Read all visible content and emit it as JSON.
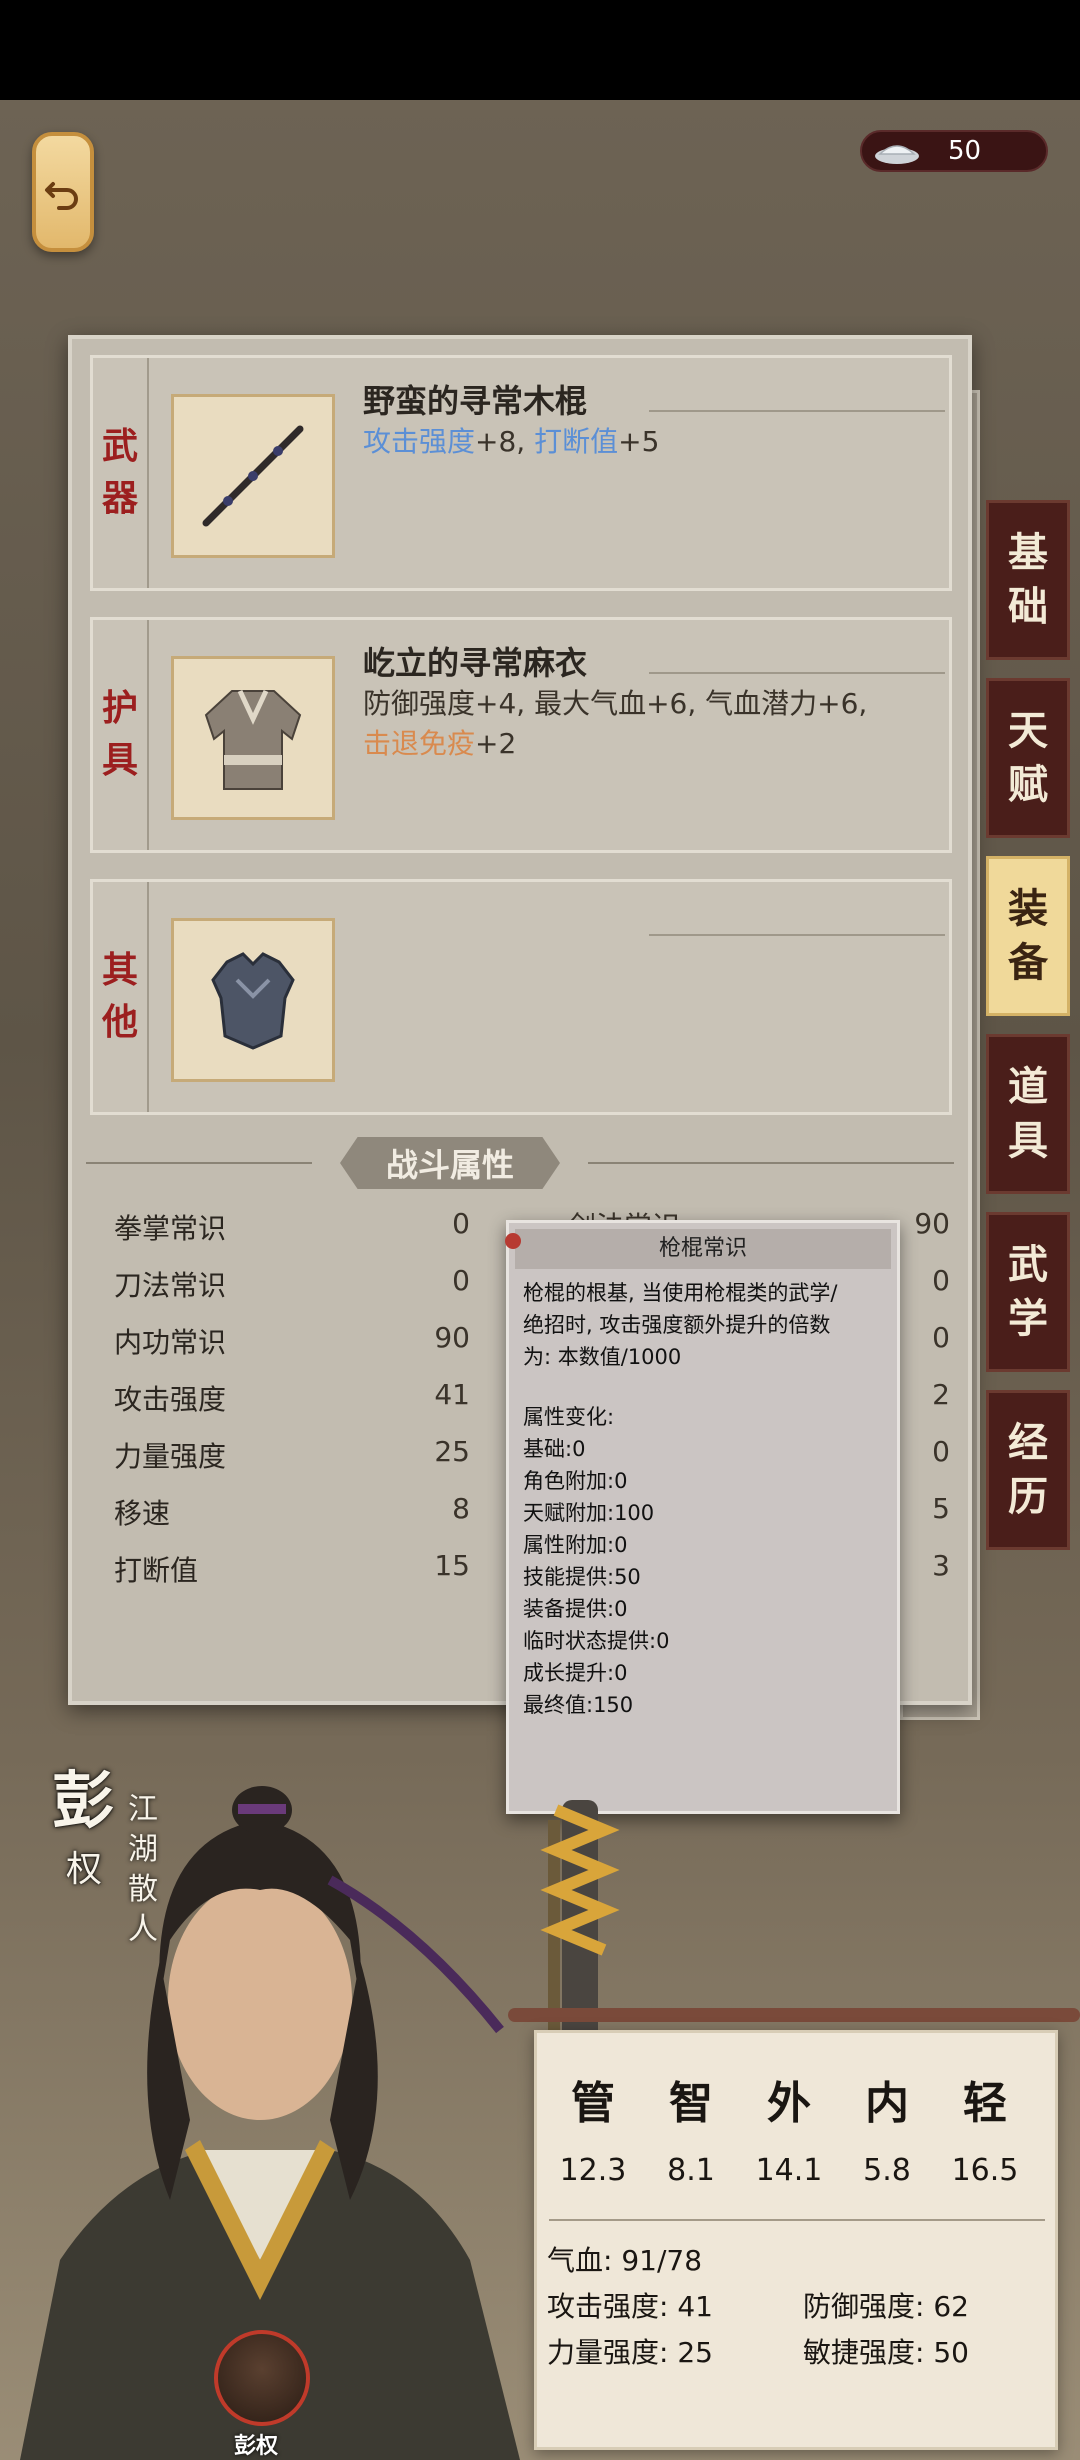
{
  "currency": {
    "value": "50"
  },
  "equipment": [
    {
      "category": [
        "武",
        "器"
      ],
      "name": "野蛮的寻常木棍",
      "stats_line1": [
        {
          "text": "攻击强度",
          "color": "blue"
        },
        {
          "text": "+8,  ",
          "color": "plain"
        },
        {
          "text": "打断值",
          "color": "blue"
        },
        {
          "text": "+5",
          "color": "plain"
        }
      ],
      "stats_line2": []
    },
    {
      "category": [
        "护",
        "具"
      ],
      "name": "屹立的寻常麻衣",
      "stats_line1": [
        {
          "text": "防御强度+4,  最大气血+6,  气血潜力+6,",
          "color": "plain"
        }
      ],
      "stats_line2": [
        {
          "text": "击退免疫",
          "color": "orange"
        },
        {
          "text": "+2",
          "color": "plain"
        }
      ]
    },
    {
      "category": [
        "其",
        "他"
      ],
      "name": "",
      "stats_line1": [],
      "stats_line2": []
    }
  ],
  "combat": {
    "title": "战斗属性",
    "left": [
      {
        "label": "拳掌常识",
        "value": "0"
      },
      {
        "label": "刀法常识",
        "value": "0"
      },
      {
        "label": "内功常识",
        "value": "90"
      },
      {
        "label": "攻击强度",
        "value": "41"
      },
      {
        "label": "力量强度",
        "value": "25"
      },
      {
        "label": "移速",
        "value": "8"
      },
      {
        "label": "打断值",
        "value": "15"
      }
    ],
    "right_label_partial": "剑法常识",
    "right_values": [
      "90",
      "0",
      "0",
      "2",
      "0",
      "5",
      "3"
    ]
  },
  "tabs": [
    {
      "chars": [
        "基",
        "础"
      ],
      "active": false
    },
    {
      "chars": [
        "天",
        "赋"
      ],
      "active": false
    },
    {
      "chars": [
        "装",
        "备"
      ],
      "active": true
    },
    {
      "chars": [
        "道",
        "具"
      ],
      "active": false
    },
    {
      "chars": [
        "武",
        "学"
      ],
      "active": false
    },
    {
      "chars": [
        "经",
        "历"
      ],
      "active": false
    }
  ],
  "tooltip": {
    "title": "枪棍常识",
    "desc": [
      "枪棍的根基, 当使用枪棍类的武学/",
      "绝招时, 攻击强度额外提升的倍数",
      "为: 本数值/1000"
    ],
    "lines": [
      "属性变化:",
      "基础:0",
      "角色附加:0",
      "天赋附加:100",
      "属性附加:0",
      "技能提供:50",
      "装备提供:0",
      "临时状态提供:0",
      "成长提升:0",
      "最终值:150"
    ]
  },
  "hero": {
    "surname": "彭",
    "given": "权",
    "title_chars": [
      "江",
      "湖",
      "散",
      "人"
    ],
    "avatar_label": "彭权"
  },
  "attributes": {
    "heads": [
      "管",
      "智",
      "外",
      "内",
      "轻"
    ],
    "values": [
      "12.3",
      "8.1",
      "14.1",
      "5.8",
      "16.5"
    ],
    "hp": "气血:  91/78",
    "attack": "攻击强度:  41",
    "defense": "防御强度:  62",
    "strength": "力量强度:  25",
    "agility": "敏捷强度:  50"
  }
}
